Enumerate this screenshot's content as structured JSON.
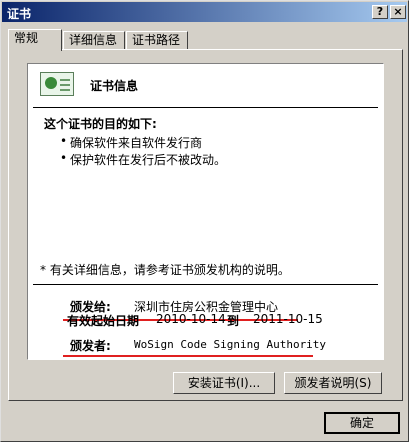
{
  "window": {
    "title": "证书",
    "help_label": "?",
    "close_label": "×"
  },
  "tabs": [
    {
      "label": "常规",
      "active": true
    },
    {
      "label": "详细信息",
      "active": false
    },
    {
      "label": "证书路径",
      "active": false
    }
  ],
  "certificate": {
    "heading": "证书信息",
    "purpose_title": "这个证书的目的如下:",
    "purposes": [
      "确保软件来自软件发行商",
      "保护软件在发行后不被改动。"
    ],
    "note": "* 有关详细信息，请参考证书颁发机构的说明。",
    "issued_to_label": "颁发给:",
    "issued_to_value": "深圳市住房公积金管理中心",
    "issued_by_label": "颁发者:",
    "issued_by_value": "WoSign Code Signing Authority",
    "valid_from_label": "有效起始日期",
    "valid_from_value": "2010-10-14",
    "valid_to_label": "到",
    "valid_to_value": "2011-10-15"
  },
  "buttons": {
    "install": "安装证书(I)...",
    "issuer_statement": "颁发者说明(S)",
    "ok": "确定"
  },
  "colors": {
    "annotation_underline": "#e02020",
    "titlebar": "#0a246a"
  }
}
